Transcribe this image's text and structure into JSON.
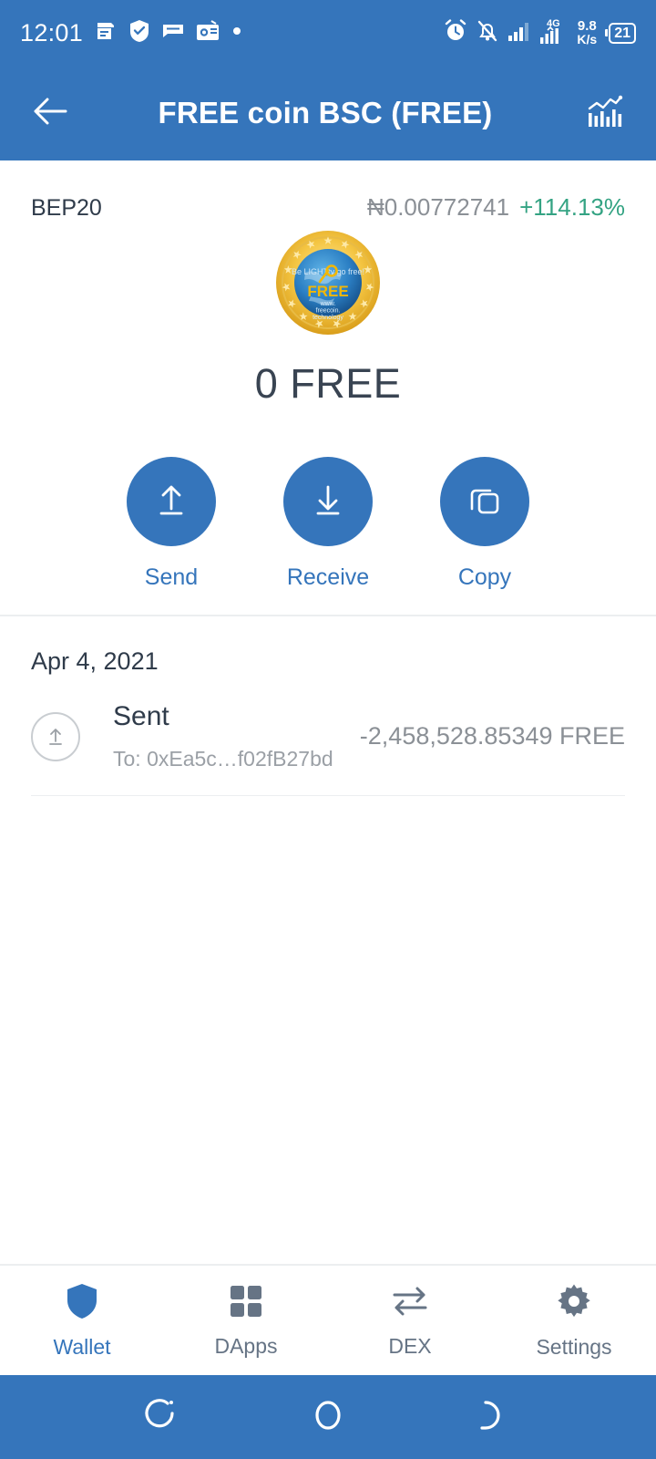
{
  "status_bar": {
    "clock": "12:01",
    "network_speed_value": "9.8",
    "network_speed_unit": "K/s",
    "battery_level": "21",
    "mobile_network": "4G",
    "left_icons": [
      "note-icon",
      "shield-check-icon",
      "message-icon",
      "radio-icon",
      "dot-icon"
    ],
    "right_icons": [
      "alarm-icon",
      "notifications-off-icon",
      "signal-bars-icon",
      "signal-4g-icon"
    ]
  },
  "app_bar": {
    "back_icon": "arrow-left-icon",
    "title": "FREE coin BSC (FREE)",
    "chart_icon": "chart-bar-icon"
  },
  "token": {
    "network_badge": "BEP20",
    "fiat_price": "₦0.00772741",
    "price_change": "+114.13%",
    "logo_text": "FREE",
    "logo_sub1": "www.",
    "logo_sub2": "freecoin.",
    "logo_sub3": "technology",
    "balance": "0 FREE"
  },
  "actions": [
    {
      "label": "Send",
      "icon": "upload-arrow-icon"
    },
    {
      "label": "Receive",
      "icon": "download-arrow-icon"
    },
    {
      "label": "Copy",
      "icon": "copy-squares-icon"
    }
  ],
  "transactions": {
    "date_header": "Apr 4, 2021",
    "items": [
      {
        "icon": "sent-arrow-icon",
        "type": "Sent",
        "to": "To: 0xEa5c…f02fB27bd",
        "amount": "-2,458,528.85349 FREE"
      }
    ]
  },
  "tab_bar": [
    {
      "label": "Wallet",
      "icon": "shield-icon",
      "active": true
    },
    {
      "label": "DApps",
      "icon": "grid-squares-icon",
      "active": false
    },
    {
      "label": "DEX",
      "icon": "swap-arrows-icon",
      "active": false
    },
    {
      "label": "Settings",
      "icon": "gear-icon",
      "active": false
    }
  ],
  "nav_bar": [
    {
      "name": "recent-apps-button",
      "icon": "recent-apps-icon"
    },
    {
      "name": "home-button",
      "icon": "home-circle-icon"
    },
    {
      "name": "back-button",
      "icon": "back-arc-icon"
    }
  ],
  "colors": {
    "brand_blue": "#3575bb",
    "positive_green": "#34a383",
    "muted_gray": "#8b9096",
    "text_dark": "#2f3b4a"
  }
}
